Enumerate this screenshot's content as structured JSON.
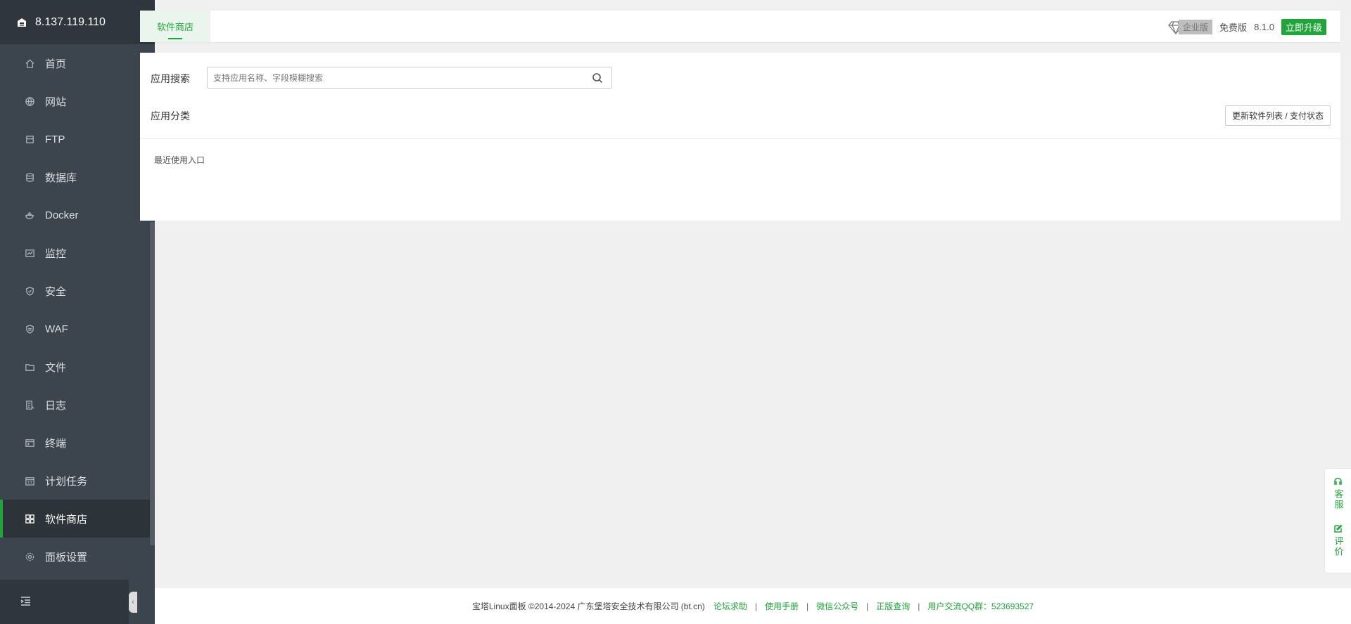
{
  "sidebar": {
    "ip": "8.137.119.110",
    "items": [
      {
        "label": "首页",
        "icon": "home-icon"
      },
      {
        "label": "网站",
        "icon": "globe-icon"
      },
      {
        "label": "FTP",
        "icon": "ftp-icon"
      },
      {
        "label": "数据库",
        "icon": "database-icon"
      },
      {
        "label": "Docker",
        "icon": "docker-icon"
      },
      {
        "label": "监控",
        "icon": "monitor-icon"
      },
      {
        "label": "安全",
        "icon": "shield-icon"
      },
      {
        "label": "WAF",
        "icon": "waf-icon"
      },
      {
        "label": "文件",
        "icon": "folder-icon"
      },
      {
        "label": "日志",
        "icon": "log-icon"
      },
      {
        "label": "终端",
        "icon": "terminal-icon"
      },
      {
        "label": "计划任务",
        "icon": "calendar-icon"
      },
      {
        "label": "软件商店",
        "icon": "grid-icon",
        "active": true
      },
      {
        "label": "面板设置",
        "icon": "gear-icon"
      }
    ]
  },
  "topbar": {
    "tab_label": "软件商店",
    "enterprise_label": "企业版",
    "free_label": "免费版",
    "version": "8.1.0",
    "upgrade_label": "立即升级"
  },
  "main": {
    "search_label": "应用搜索",
    "search_placeholder": "支持应用名称、字段模糊搜索",
    "category_label": "应用分类",
    "update_button": "更新软件列表 / 支付状态",
    "recent_label": "最近使用入口"
  },
  "footer": {
    "copyright": "宝塔Linux面板 ©2014-2024 广东堡塔安全技术有限公司 (bt.cn)",
    "links": [
      "论坛求助",
      "使用手册",
      "微信公众号",
      "正版查询",
      "用户交流QQ群：523693527"
    ]
  },
  "float": {
    "service": "客服",
    "review": "评价"
  },
  "colors": {
    "accent": "#20a53a",
    "sidebar_bg": "#3c444d",
    "sidebar_header": "#2f363d"
  }
}
